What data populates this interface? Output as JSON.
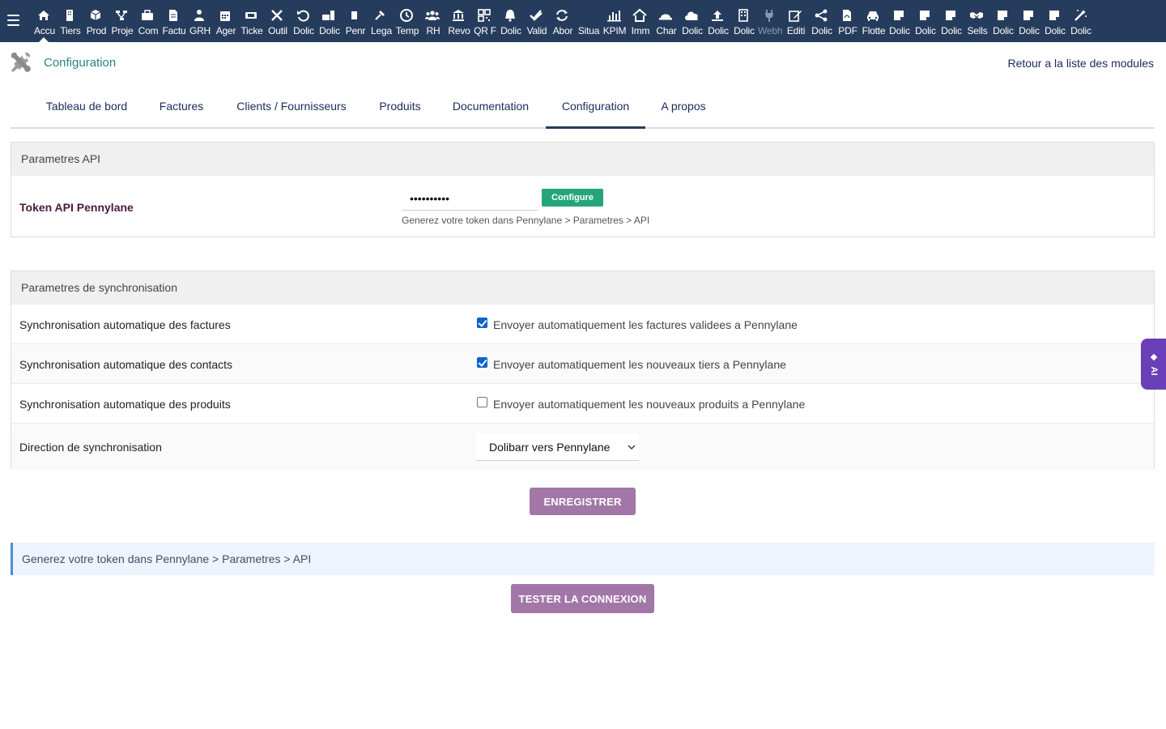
{
  "topbar": {
    "menu_icon": "hamburger-icon",
    "items": [
      {
        "label": "Accu",
        "icon": "home-icon",
        "active": true
      },
      {
        "label": "Tiers",
        "icon": "building-icon"
      },
      {
        "label": "Prod",
        "icon": "cube-icon"
      },
      {
        "label": "Proje",
        "icon": "sitemap-icon"
      },
      {
        "label": "Com",
        "icon": "briefcase-icon"
      },
      {
        "label": "Factu",
        "icon": "invoice-icon"
      },
      {
        "label": "GRH",
        "icon": "user-tie-icon"
      },
      {
        "label": "Ager",
        "icon": "calendar-icon"
      },
      {
        "label": "Ticke",
        "icon": "ticket-icon"
      },
      {
        "label": "Outil",
        "icon": "tools-icon"
      },
      {
        "label": "Dolic",
        "icon": "undo-icon"
      },
      {
        "label": "Dolic",
        "icon": "briefcase-page-icon"
      },
      {
        "label": "Penr",
        "icon": "note-icon"
      },
      {
        "label": "Lega",
        "icon": "gavel-icon"
      },
      {
        "label": "Temp",
        "icon": "clock-icon"
      },
      {
        "label": "RH",
        "icon": "users-icon"
      },
      {
        "label": "Revo",
        "icon": "bank-icon"
      },
      {
        "label": "QR F",
        "icon": "qrcode-icon"
      },
      {
        "label": "Dolic",
        "icon": "bell-icon"
      },
      {
        "label": "Valid",
        "icon": "double-check-icon"
      },
      {
        "label": "Abor",
        "icon": "sync-icon"
      },
      {
        "label": "Situa",
        "icon": "blank-icon"
      },
      {
        "label": "KPIM",
        "icon": "bar-chart-icon"
      },
      {
        "label": "Imm",
        "icon": "house-icon"
      },
      {
        "label": "Char",
        "icon": "hardhat-icon"
      },
      {
        "label": "Dolic",
        "icon": "cloud-icon"
      },
      {
        "label": "Dolic",
        "icon": "upload-icon"
      },
      {
        "label": "Dolic",
        "icon": "office-building-icon"
      },
      {
        "label": "Webh",
        "icon": "plug-icon",
        "dim": true
      },
      {
        "label": "Editi",
        "icon": "edit-icon"
      },
      {
        "label": "Dolic",
        "icon": "share-icon"
      },
      {
        "label": "PDF",
        "icon": "pdf-icon"
      },
      {
        "label": "Flotte",
        "icon": "car-icon"
      },
      {
        "label": "Dolic",
        "icon": "sticky-note-icon"
      },
      {
        "label": "Dolic",
        "icon": "sticky-note-icon"
      },
      {
        "label": "Dolic",
        "icon": "sticky-note-icon"
      },
      {
        "label": "Sells",
        "icon": "handshake-icon"
      },
      {
        "label": "Dolic",
        "icon": "sticky-note-icon"
      },
      {
        "label": "Dolic",
        "icon": "sticky-note-icon"
      },
      {
        "label": "Dolic",
        "icon": "sticky-note-icon"
      },
      {
        "label": "Dolic",
        "icon": "magic-wand-icon"
      }
    ]
  },
  "header": {
    "icon": "tools-icon",
    "title": "Configuration",
    "back_link": "Retour a la liste des modules"
  },
  "tabs": [
    {
      "label": "Tableau de bord"
    },
    {
      "label": "Factures"
    },
    {
      "label": "Clients / Fournisseurs"
    },
    {
      "label": "Produits"
    },
    {
      "label": "Documentation"
    },
    {
      "label": "Configuration",
      "active": true
    },
    {
      "label": "A propos"
    }
  ],
  "api_section": {
    "title": "Parametres API",
    "token_label": "Token API Pennylane",
    "token_value": "••••••••••",
    "configure_label": "Configure",
    "hint": "Generez votre token dans Pennylane > Parametres > API"
  },
  "sync_section": {
    "title": "Parametres de synchronisation",
    "rows": [
      {
        "label": "Synchronisation automatique des factures",
        "checked": true,
        "text": "Envoyer automatiquement les factures validees a Pennylane"
      },
      {
        "label": "Synchronisation automatique des contacts",
        "checked": true,
        "text": "Envoyer automatiquement les nouveaux tiers a Pennylane"
      },
      {
        "label": "Synchronisation automatique des produits",
        "checked": false,
        "text": "Envoyer automatiquement les nouveaux produits a Pennylane"
      }
    ],
    "direction_label": "Direction de synchronisation",
    "direction_value": "Dolibarr vers Pennylane"
  },
  "save_button": "ENREGISTRER",
  "info_box": "Generez votre token dans Pennylane > Parametres > API",
  "test_button": "TESTER LA CONNEXION",
  "ai_tab": {
    "label": "AI",
    "icon": "diamond-icon"
  },
  "colors": {
    "topbar": "#263c5c",
    "accent_teal": "#24857e",
    "button_purple": "#a277a8",
    "configure_green": "#25a57a",
    "ai_purple": "#6a3fb8",
    "checkbox_blue": "#0b63ce"
  }
}
